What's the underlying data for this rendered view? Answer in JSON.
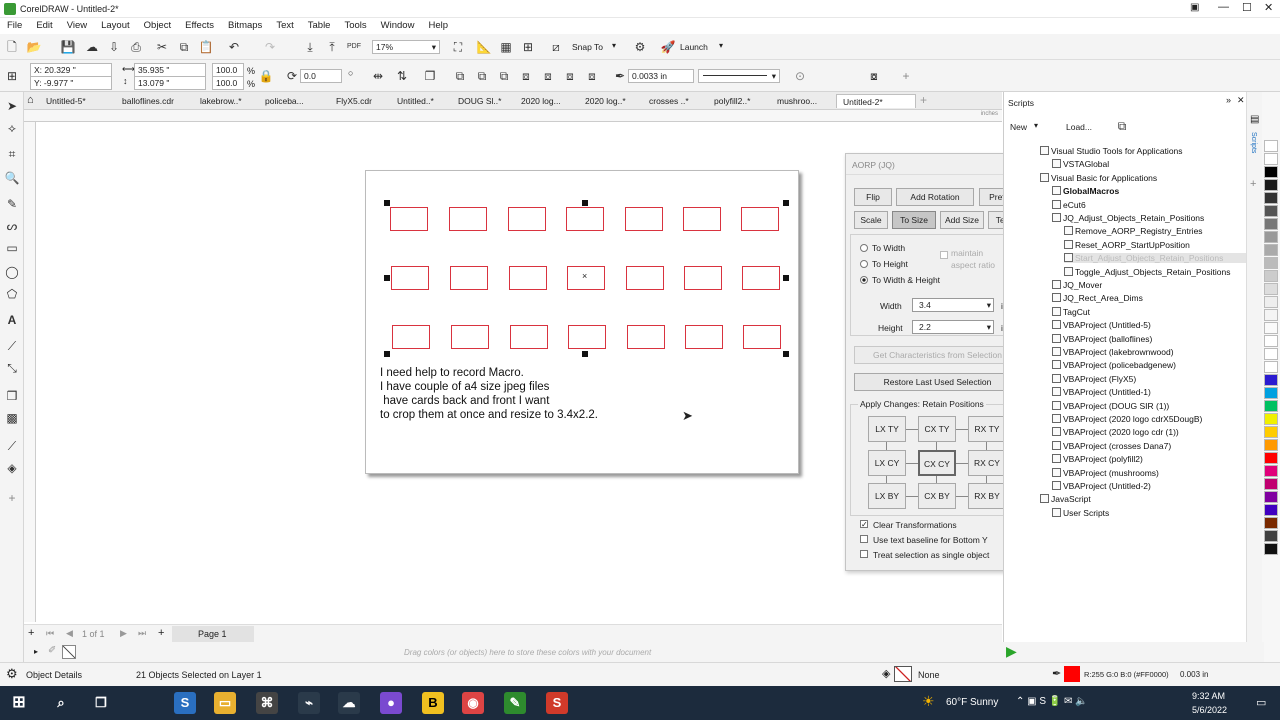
{
  "window": {
    "title": "CorelDRAW - Untitled-2*"
  },
  "menu": [
    "File",
    "Edit",
    "View",
    "Layout",
    "Object",
    "Effects",
    "Bitmaps",
    "Text",
    "Table",
    "Tools",
    "Window",
    "Help"
  ],
  "toolbar": {
    "zoom": "17%",
    "snap": "Snap To",
    "launch": "Launch"
  },
  "props": {
    "x": "X: 20.329 \"",
    "y": "Y: -9.977 \"",
    "w": "35.935 \"",
    "h": "13.079 \"",
    "sx": "100.0",
    "sy": "100.0",
    "pct": "%",
    "angle": "0.0",
    "outline": "0.0033 in"
  },
  "tabs": [
    "Untitled-5*",
    "balloflines.cdr",
    "lakebrow..*",
    "policeba...",
    "FlyX5.cdr",
    "Untitled..*",
    "DOUG Sl..*",
    "2020 log...",
    "2020 log..*",
    "crosses ..*",
    "polyfill2..*",
    "mushroo...",
    "Untitled-2*"
  ],
  "ruler": {
    "unit": "inches"
  },
  "note": "I need help to record Macro.\nI have couple of a4 size jpeg files\n have cards back and front I want\nto crop them at once and resize to 3.4x2.2.",
  "aorp": {
    "title": "AORP (JQ)",
    "row1": [
      "Flip",
      "Add Rotation",
      "Prefs"
    ],
    "row2": [
      "Scale",
      "To Size",
      "Add Size",
      "Text"
    ],
    "radios": [
      "To Width",
      "To Height",
      "To Width & Height"
    ],
    "maintain": "maintain aspect ratio",
    "width_label": "Width",
    "width_value": "3.4",
    "height_label": "Height",
    "height_value": "2.2",
    "unit": "in",
    "get_chars": "Get Characteristics from Selection",
    "restore": "Restore Last Used Selection",
    "apply_title": "Apply Changes: Retain Positions",
    "grid": [
      "LX TY",
      "CX TY",
      "RX TY",
      "LX CY",
      "CX CY",
      "RX CY",
      "LX BY",
      "CX BY",
      "RX BY"
    ],
    "checks": [
      {
        "label": "Clear Transformations",
        "checked": true
      },
      {
        "label": "Use text baseline for Bottom Y",
        "checked": false
      },
      {
        "label": "Treat selection as single object",
        "checked": false
      }
    ]
  },
  "scripts": {
    "title": "Scripts",
    "new": "New",
    "load": "Load...",
    "items": [
      "Visual Studio Tools for Applications",
      "VSTAGlobal",
      "Visual Basic for Applications",
      "GlobalMacros",
      "eCut6",
      "JQ_Adjust_Objects_Retain_Positions",
      "Remove_AORP_Registry_Entries",
      "Reset_AORP_StartUpPosition",
      "Start_Adjust_Objects_Retain_Positions",
      "Toggle_Adjust_Objects_Retain_Positions",
      "JQ_Mover",
      "JQ_Rect_Area_Dims",
      "TagCut",
      "VBAProject (Untitled-5)",
      "VBAProject (balloflines)",
      "VBAProject (lakebrownwood)",
      "VBAProject (policebadgenew)",
      "VBAProject (FlyX5)",
      "VBAProject (Untitled-1)",
      "VBAProject (DOUG SIR (1))",
      "VBAProject (2020 logo cdrX5DougB)",
      "VBAProject (2020 logo cdr (1))",
      "VBAProject (crosses Dana7)",
      "VBAProject (polyfill2)",
      "VBAProject (mushrooms)",
      "VBAProject (Untitled-2)",
      "JavaScript",
      "User Scripts"
    ]
  },
  "pagebar": {
    "count": "1 of 1",
    "page": "Page 1"
  },
  "colorbar_hint": "Drag colors (or objects) here to store these colors with your document",
  "status": {
    "details": "Object Details",
    "selection": "21 Objects Selected on Layer 1",
    "fill": "None",
    "color": "R:255 G:0 B:0 (#FF0000)",
    "outline": "0.003 in"
  },
  "taskbar": {
    "weather": "60°F  Sunny",
    "time": "9:32 AM",
    "date": "5/6/2022"
  },
  "colors": {
    "card": "#d9333f",
    "taskbar": "#1c2b3d"
  }
}
